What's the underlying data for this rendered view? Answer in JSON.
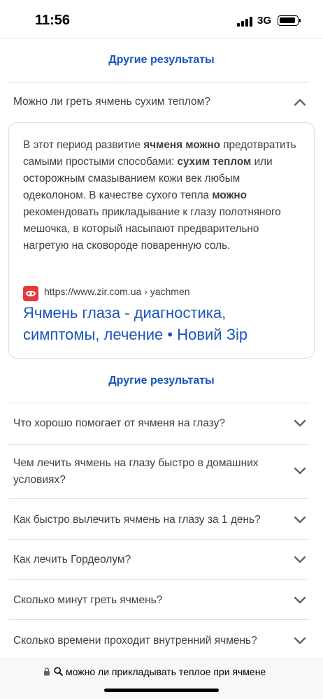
{
  "status_bar": {
    "time": "11:56",
    "network": "3G"
  },
  "more_results_top": "Другие результаты",
  "expanded_question": "Можно ли греть ячмень сухим теплом?",
  "answer": {
    "parts": [
      {
        "text": "В этот период развитие ",
        "bold": false
      },
      {
        "text": "ячменя можно",
        "bold": true
      },
      {
        "text": " предотвратить самыми простыми способами: ",
        "bold": false
      },
      {
        "text": "сухим теплом",
        "bold": true
      },
      {
        "text": " или осторожным смазыванием кожи век любым одеколоном. В качестве сухого тепла ",
        "bold": false
      },
      {
        "text": "можно",
        "bold": true
      },
      {
        "text": " рекомендовать прикладывание к глазу полотняного мешочка, в который насыпают предварительно нагретую на сковороде поваренную соль.",
        "bold": false
      }
    ],
    "source_url": "https://www.zir.com.ua › yachmen",
    "source_title": "Ячмень глаза - диагностика, симптомы, лечение • Новий Зір"
  },
  "more_results_bottom": "Другие результаты",
  "questions": [
    "Что хорошо помогает от ячменя на глазу?",
    "Чем лечить ячмень на глазу быстро в домашних условиях?",
    "Как быстро вылечить ячмень на глазу за 1 день?",
    "Как лечить Гордеолум?",
    "Сколько минут греть ячмень?",
    "Сколько времени проходит внутренний ячмень?"
  ],
  "address_bar": {
    "query": "можно ли прикладывать теплое при ячмене"
  },
  "colors": {
    "link": "#1a56b8",
    "text": "#3c4043",
    "divider": "#dadce0",
    "favicon": "#e5383b"
  }
}
